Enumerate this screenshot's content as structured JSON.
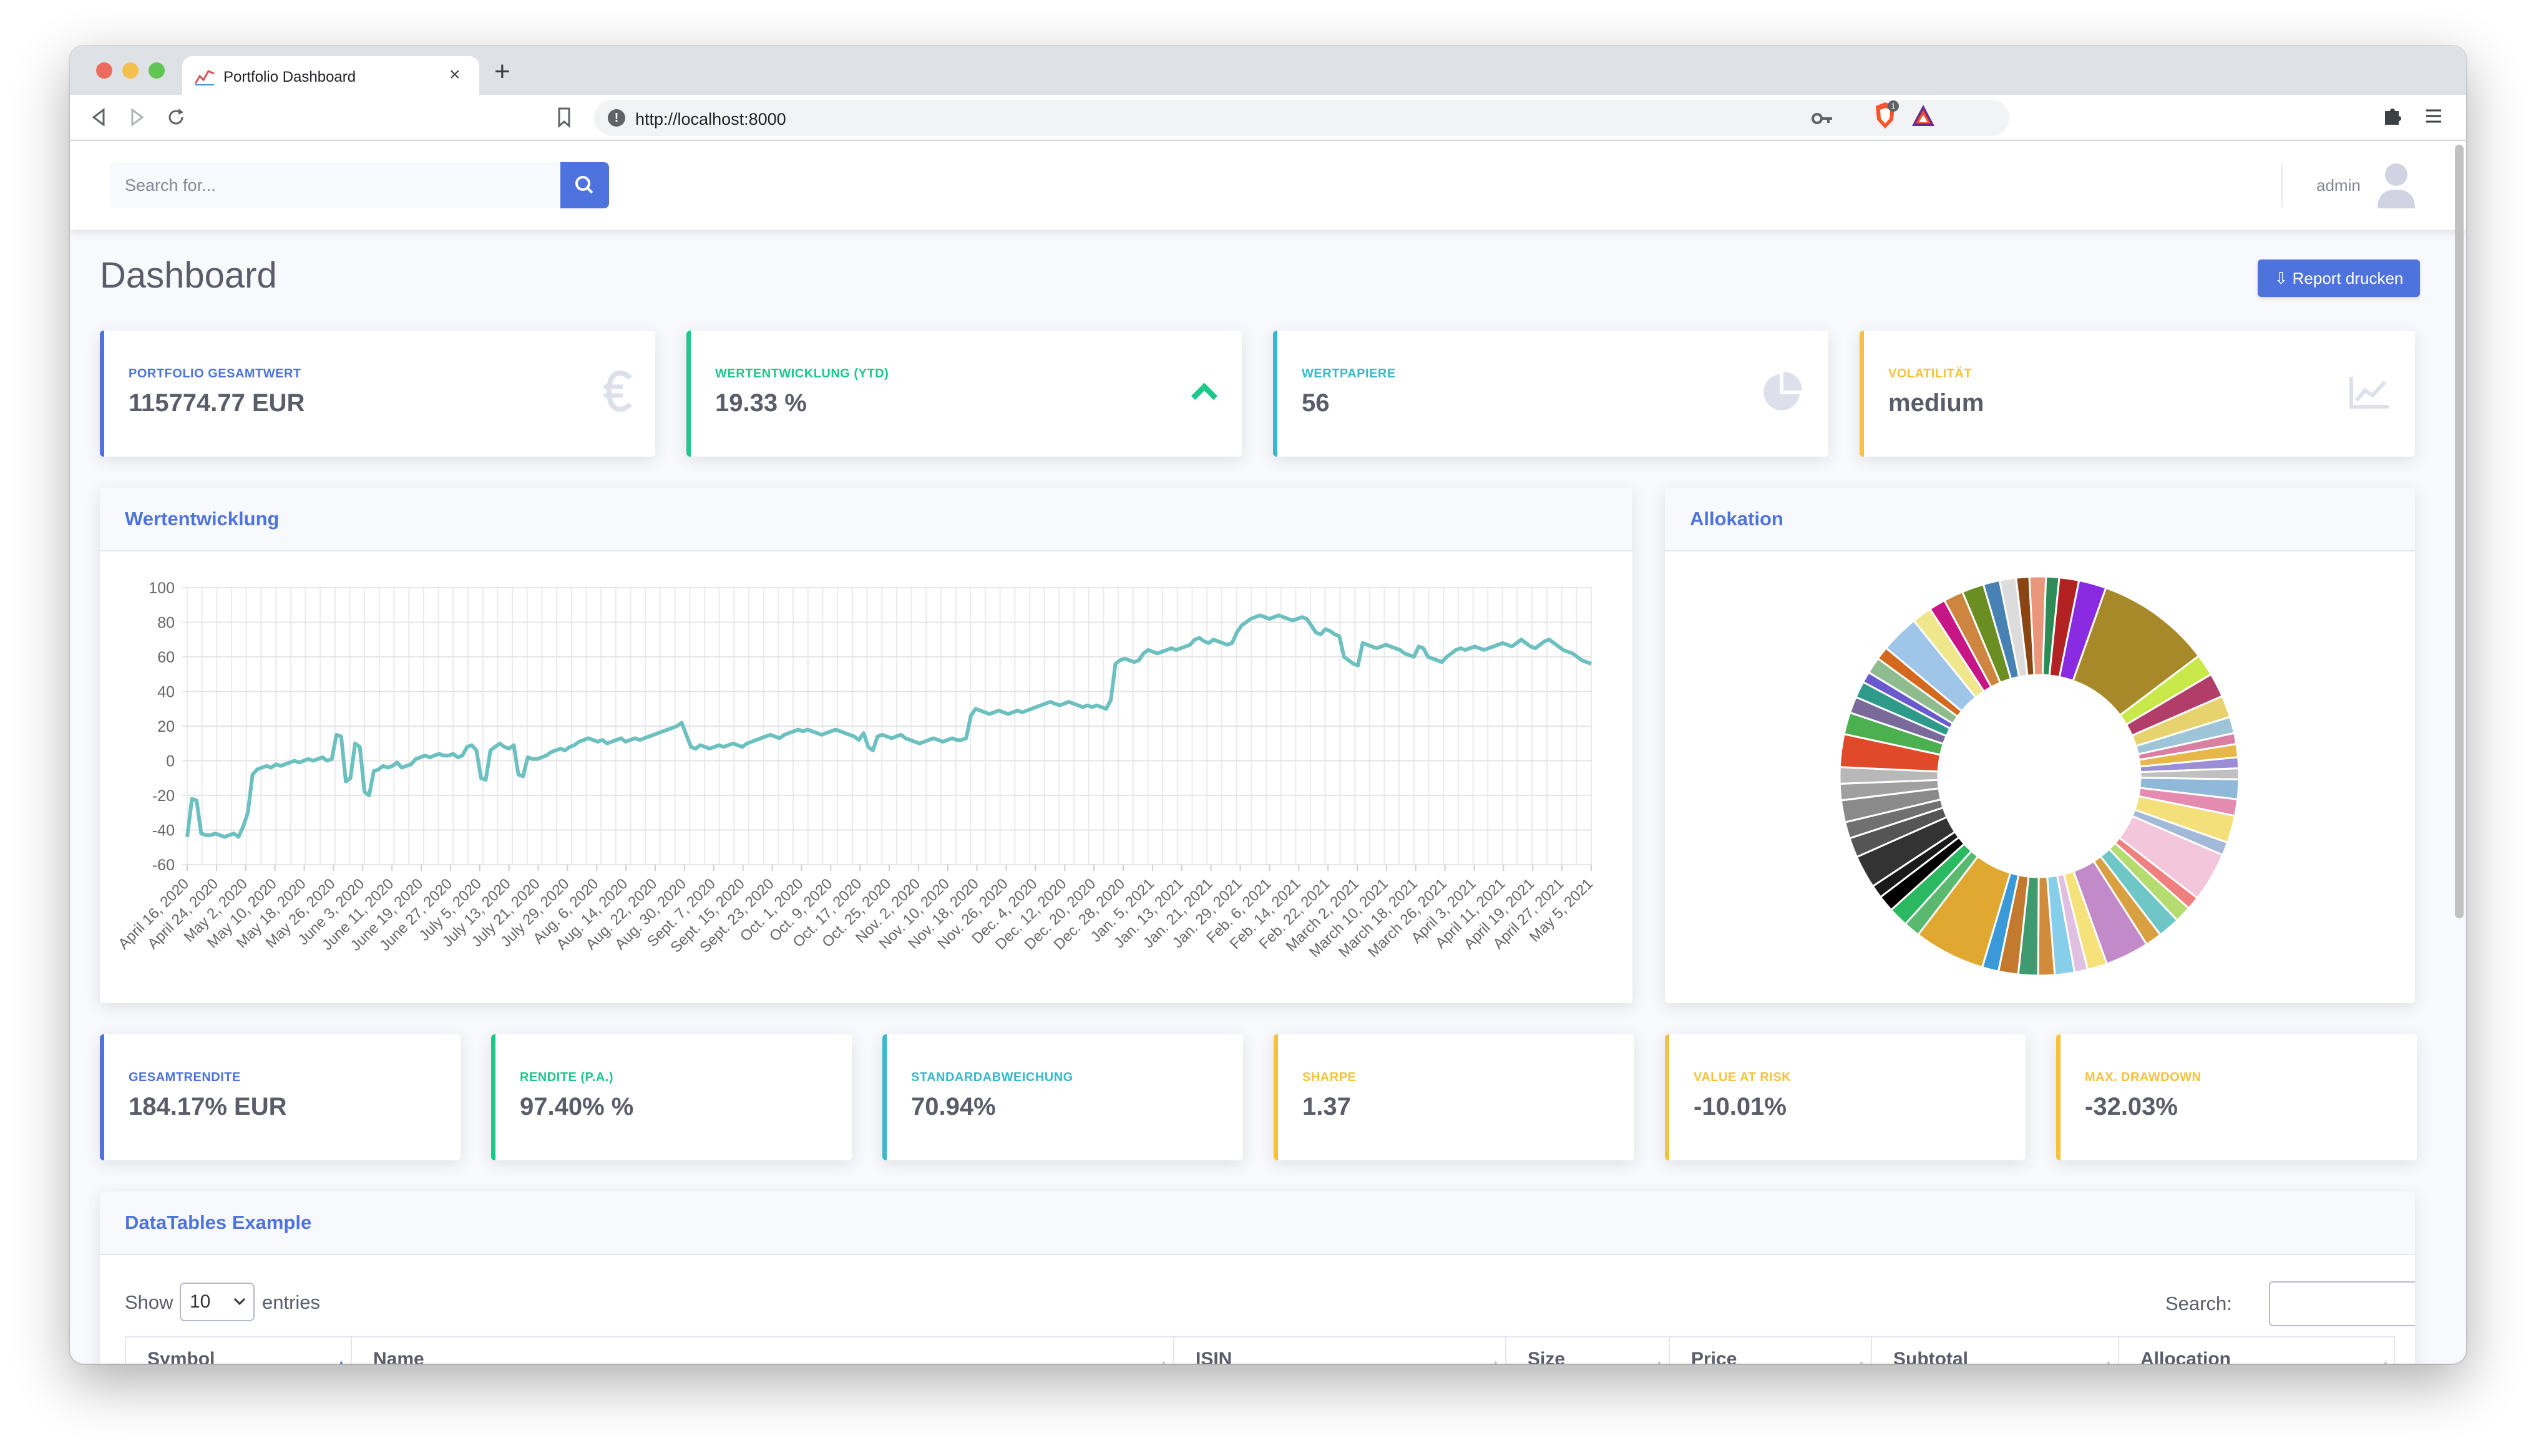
{
  "browser": {
    "tab_title": "Portfolio Dashboard",
    "url": "http://localhost:8000",
    "tab_close_glyph": "×",
    "new_tab_glyph": "+",
    "icons": [
      "back-icon",
      "forward-icon",
      "reload-icon",
      "bookmark-icon",
      "site-info-icon",
      "key-icon",
      "brave-shield-icon",
      "brave-rewards-icon",
      "extensions-icon",
      "menu-icon"
    ]
  },
  "topbar": {
    "search_placeholder": "Search for...",
    "user_name": "admin"
  },
  "page": {
    "title": "Dashboard",
    "report_button": "Report drucken"
  },
  "kpis_top": [
    {
      "label": "Portfolio Gesamtwert",
      "value": "115774.77 EUR",
      "color": "#4e73df",
      "icon": "euro-icon"
    },
    {
      "label": "Wertentwicklung (YTD)",
      "value": "19.33 %",
      "color": "#1cc88a",
      "icon": "chevron-up-icon"
    },
    {
      "label": "Wertpapiere",
      "value": "56",
      "color": "#36b9cc",
      "icon": "pie-chart-icon"
    },
    {
      "label": "Volatilität",
      "value": "medium",
      "color": "#f6c23e",
      "icon": "line-chart-icon"
    }
  ],
  "line_card": {
    "title": "Wertentwicklung"
  },
  "pie_card": {
    "title": "Allokation"
  },
  "kpis_bottom": [
    {
      "label": "Gesamtrendite",
      "value": "184.17% EUR",
      "color": "#4e73df"
    },
    {
      "label": "Rendite (p.a.)",
      "value": "97.40% %",
      "color": "#1cc88a"
    },
    {
      "label": "Standardabweichung",
      "value": "70.94%",
      "color": "#36b9cc"
    },
    {
      "label": "Sharpe",
      "value": "1.37",
      "color": "#f6c23e"
    },
    {
      "label": "Value at Risk",
      "value": "-10.01%",
      "color": "#f6c23e"
    },
    {
      "label": "Max. Drawdown",
      "value": "-32.03%",
      "color": "#f6c23e"
    }
  ],
  "datatable": {
    "title": "DataTables Example",
    "show_label": "Show",
    "entries_label": "entries",
    "page_size": "10",
    "search_label": "Search:",
    "columns": [
      "Symbol",
      "Name",
      "ISIN",
      "Size",
      "Price",
      "Subtotal",
      "Allocation"
    ]
  },
  "chart_data": [
    {
      "type": "line",
      "title": "Wertentwicklung",
      "ylim": [
        -60,
        100
      ],
      "yticks": [
        100,
        80,
        60,
        40,
        20,
        0,
        -20,
        -40,
        -60
      ],
      "grid": true,
      "line_color": "#6cc0c0",
      "x_tick_labels": [
        "April 16, 2020",
        "April 24, 2020",
        "May 2, 2020",
        "May 10, 2020",
        "May 18, 2020",
        "May 26, 2020",
        "June 3, 2020",
        "June 11, 2020",
        "June 19, 2020",
        "June 27, 2020",
        "July 5, 2020",
        "July 13, 2020",
        "July 21, 2020",
        "July 29, 2020",
        "Aug. 6, 2020",
        "Aug. 14, 2020",
        "Aug. 22, 2020",
        "Aug. 30, 2020",
        "Sept. 7, 2020",
        "Sept. 15, 2020",
        "Sept. 23, 2020",
        "Oct. 1, 2020",
        "Oct. 9, 2020",
        "Oct. 17, 2020",
        "Oct. 25, 2020",
        "Nov. 2, 2020",
        "Nov. 10, 2020",
        "Nov. 18, 2020",
        "Nov. 26, 2020",
        "Dec. 4, 2020",
        "Dec. 12, 2020",
        "Dec. 20, 2020",
        "Dec. 28, 2020",
        "Jan. 5, 2021",
        "Jan. 13, 2021",
        "Jan. 21, 2021",
        "Jan. 29, 2021",
        "Feb. 6, 2021",
        "Feb. 14, 2021",
        "Feb. 22, 2021",
        "March 2, 2021",
        "March 10, 2021",
        "March 18, 2021",
        "March 26, 2021",
        "April 3, 2021",
        "April 11, 2021",
        "April 19, 2021",
        "April 27, 2021",
        "May 5, 2021"
      ],
      "series": [
        {
          "values": [
            -44,
            -22,
            -23,
            -42,
            -43,
            -43,
            -42,
            -43,
            -44,
            -43,
            -42,
            -44,
            -38,
            -30,
            -8,
            -5,
            -4,
            -3,
            -4,
            -2,
            -3,
            -2,
            -1,
            0,
            -1,
            0,
            1,
            0,
            1,
            2,
            0,
            1,
            15,
            14,
            -12,
            -10,
            10,
            8,
            -18,
            -20,
            -6,
            -5,
            -3,
            -4,
            -3,
            -1,
            -4,
            -3,
            -2,
            1,
            2,
            3,
            2,
            3,
            4,
            3,
            3,
            4,
            2,
            3,
            8,
            9,
            6,
            -10,
            -11,
            6,
            8,
            10,
            8,
            7,
            9,
            -8,
            -9,
            2,
            1,
            1,
            2,
            3,
            5,
            6,
            7,
            6,
            8,
            9,
            11,
            12,
            13,
            12,
            11,
            12,
            10,
            11,
            12,
            13,
            11,
            12,
            13,
            12,
            13,
            14,
            15,
            16,
            17,
            18,
            19,
            20,
            22,
            15,
            8,
            7,
            9,
            8,
            7,
            8,
            9,
            8,
            9,
            10,
            9,
            8,
            10,
            11,
            12,
            13,
            14,
            15,
            14,
            13,
            15,
            16,
            17,
            18,
            17,
            18,
            17,
            16,
            15,
            16,
            17,
            18,
            17,
            16,
            15,
            14,
            12,
            16,
            8,
            6,
            14,
            15,
            14,
            13,
            14,
            15,
            13,
            12,
            11,
            10,
            11,
            12,
            13,
            12,
            11,
            12,
            13,
            12,
            12,
            13,
            26,
            30,
            29,
            28,
            27,
            28,
            29,
            28,
            27,
            28,
            29,
            28,
            29,
            30,
            31,
            32,
            33,
            34,
            33,
            32,
            33,
            34,
            33,
            32,
            31,
            32,
            31,
            32,
            31,
            30,
            35,
            56,
            58,
            59,
            58,
            57,
            58,
            62,
            64,
            63,
            62,
            63,
            64,
            65,
            64,
            65,
            66,
            67,
            70,
            71,
            69,
            68,
            70,
            69,
            68,
            67,
            68,
            74,
            78,
            80,
            82,
            83,
            84,
            83,
            82,
            83,
            84,
            83,
            82,
            81,
            82,
            83,
            82,
            78,
            74,
            73,
            76,
            75,
            73,
            72,
            60,
            58,
            56,
            55,
            68,
            67,
            66,
            65,
            66,
            67,
            66,
            65,
            64,
            62,
            61,
            60,
            66,
            65,
            60,
            59,
            58,
            57,
            60,
            62,
            64,
            65,
            64,
            65,
            66,
            65,
            64,
            65,
            66,
            67,
            68,
            67,
            66,
            68,
            70,
            68,
            66,
            65,
            67,
            69,
            70,
            68,
            66,
            64,
            63,
            62,
            60,
            58,
            57,
            56
          ]
        }
      ]
    },
    {
      "type": "pie",
      "title": "Allokation",
      "donut": true,
      "values": [
        10.5,
        2.0,
        2.2,
        2.0,
        1.5,
        1.0,
        1.2,
        1.0,
        1.0,
        1.8,
        1.5,
        2.5,
        1.2,
        4.5,
        1.2,
        1.5,
        2.0,
        1.5,
        4.0,
        1.8,
        1.2,
        1.8,
        1.5,
        1.8,
        1.8,
        1.5,
        6.5,
        1.5,
        1.8,
        1.5,
        1.2,
        3.0,
        1.8,
        1.5,
        2.0,
        1.5,
        1.5,
        3.0,
        2.0,
        1.5,
        1.5,
        1.0,
        1.5,
        1.2,
        3.5,
        1.8,
        1.5,
        1.8,
        2.0,
        1.5,
        1.5,
        1.2,
        1.5,
        1.2,
        1.8,
        2.5
      ],
      "colors": [
        "#a8892a",
        "#c9e94a",
        "#b33d69",
        "#e7d36e",
        "#9ec4d8",
        "#d97fa1",
        "#e6b74a",
        "#9b8dd6",
        "#c0c0c0",
        "#8fb8d9",
        "#e68bb0",
        "#f3e07a",
        "#a3b9d8",
        "#f4c6dc",
        "#f08080",
        "#b5dc6e",
        "#6ec6c6",
        "#d8a040",
        "#c38ac9",
        "#f6e27a",
        "#e0c0e0",
        "#87ceeb",
        "#d08b3b",
        "#409a70",
        "#c47a2e",
        "#3a9ad9",
        "#e0a830",
        "#5bb86f",
        "#2ab860",
        "#000000",
        "#1a1a1a",
        "#333333",
        "#555555",
        "#707070",
        "#8a8a8a",
        "#a0a0a0",
        "#b8b8b8",
        "#e04a2a",
        "#4caf50",
        "#7a6a9a",
        "#2e9a8a",
        "#6a5acd",
        "#8fbc8f",
        "#d2691e",
        "#9fc5e8",
        "#f0e68c",
        "#c71585",
        "#cd853f",
        "#6b8e23",
        "#4682b4",
        "#dcdcdc",
        "#8b4513",
        "#e9967a",
        "#2e8b57",
        "#b22222",
        "#8a2be2"
      ]
    }
  ]
}
